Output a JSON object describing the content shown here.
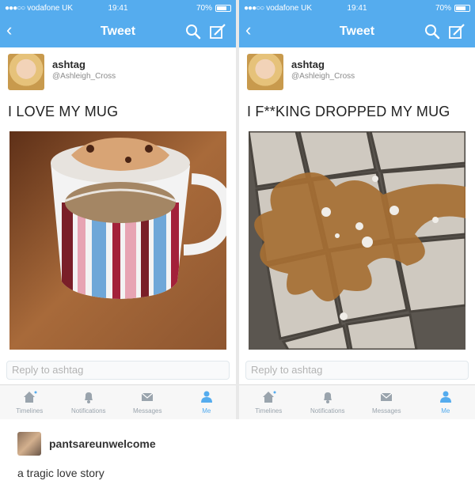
{
  "colors": {
    "accent": "#55acee",
    "tab_inactive": "#9aa4ad"
  },
  "phones": [
    {
      "status": {
        "signal": "●●●○○",
        "carrier": "vodafone UK",
        "time": "19:41",
        "battery": "70%"
      },
      "nav": {
        "back_icon": "chevron-left-icon",
        "title": "Tweet",
        "search_icon": "search-icon",
        "compose_icon": "compose-icon"
      },
      "tweet": {
        "username": "ashtag",
        "handle": "@Ashleigh_Cross",
        "text": "I LOVE MY MUG"
      },
      "reply_placeholder": "Reply to ashtag",
      "tabs": [
        {
          "label": "Timelines",
          "icon": "home-icon"
        },
        {
          "label": "Notifications",
          "icon": "bell-icon"
        },
        {
          "label": "Messages",
          "icon": "envelope-icon"
        },
        {
          "label": "Me",
          "icon": "person-icon"
        }
      ]
    },
    {
      "status": {
        "signal": "●●●○○",
        "carrier": "vodafone UK",
        "time": "19:41",
        "battery": "70%"
      },
      "nav": {
        "back_icon": "chevron-left-icon",
        "title": "Tweet",
        "search_icon": "search-icon",
        "compose_icon": "compose-icon"
      },
      "tweet": {
        "username": "ashtag",
        "handle": "@Ashleigh_Cross",
        "text": "I F**KING DROPPED MY MUG"
      },
      "reply_placeholder": "Reply to ashtag",
      "tabs": [
        {
          "label": "Timelines",
          "icon": "home-icon"
        },
        {
          "label": "Notifications",
          "icon": "bell-icon"
        },
        {
          "label": "Messages",
          "icon": "envelope-icon"
        },
        {
          "label": "Me",
          "icon": "person-icon"
        }
      ]
    }
  ],
  "comment": {
    "username": "pantsareunwelcome",
    "text": "a tragic love story"
  }
}
